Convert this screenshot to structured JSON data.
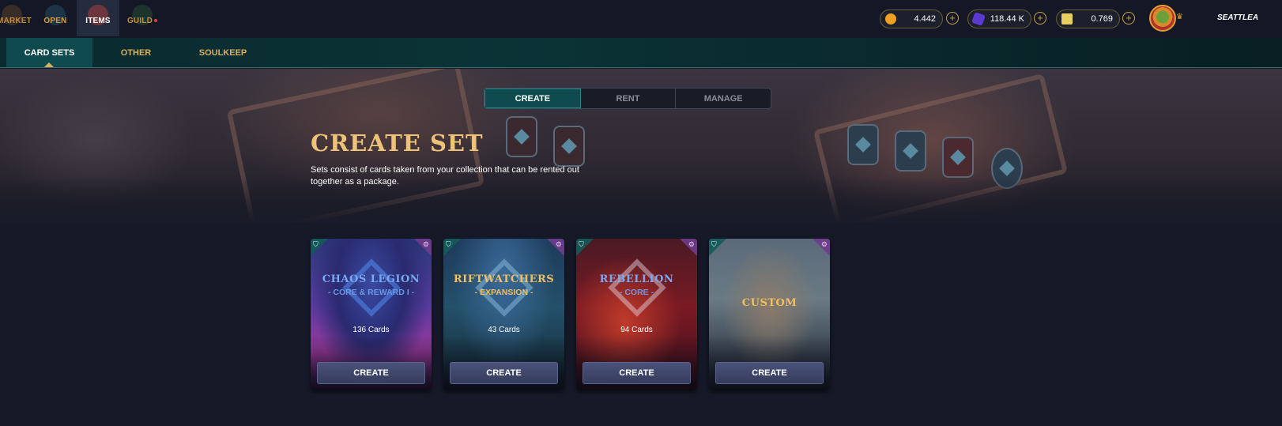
{
  "nav": {
    "market": "MARKET",
    "open": "OPEN",
    "items": "ITEMS",
    "guild": "GUILD"
  },
  "currencies": [
    {
      "icon": "gold-coin-icon",
      "value": "4.442",
      "color": "#f0a020"
    },
    {
      "icon": "crystal-icon",
      "value": "118.44 K",
      "color": "#5a3ad0"
    },
    {
      "icon": "credit-icon",
      "value": "0.769",
      "color": "#e8d060"
    }
  ],
  "user": {
    "name": "SEATTLEA"
  },
  "subtabs": {
    "card_sets": "CARD SETS",
    "other": "OTHER",
    "soulkeep": "SOULKEEP"
  },
  "segment": {
    "create": "CREATE",
    "rent": "RENT",
    "manage": "MANAGE"
  },
  "hero": {
    "title": "CREATE SET",
    "description": "Sets consist of cards taken from your collection that can be rented out together as a package."
  },
  "cards": [
    {
      "title": "CHAOS LEGION",
      "subtitle": "- CORE & REWARD I -",
      "count": "136 Cards",
      "button": "CREATE",
      "title_color": "#7aa8f0"
    },
    {
      "title": "RIFTWATCHERS",
      "subtitle": "- EXPANSION -",
      "count": "43 Cards",
      "button": "CREATE",
      "title_color": "#f0c060"
    },
    {
      "title": "REBELLION",
      "subtitle": "- CORE -",
      "count": "94 Cards",
      "button": "CREATE",
      "title_color": "#7aa8f0"
    },
    {
      "title": "CUSTOM",
      "subtitle": "",
      "count": "",
      "button": "CREATE",
      "title_color": "#f0c060"
    }
  ],
  "colors": {
    "accent": "#efc27a",
    "teal": "#0f4a4e",
    "background": "#161a28"
  }
}
